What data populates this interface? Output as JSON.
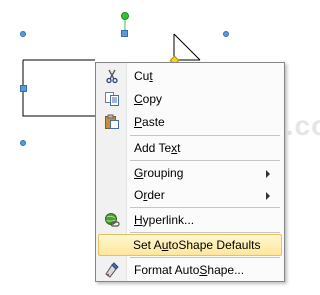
{
  "menu": {
    "items": [
      {
        "label": "Cut",
        "mnemonic_index": 2,
        "icon": "scissors-icon"
      },
      {
        "label": "Copy",
        "mnemonic_index": 0,
        "icon": "copy-icon"
      },
      {
        "label": "Paste",
        "mnemonic_index": 0,
        "icon": "paste-icon"
      },
      {
        "label": "Add Text",
        "mnemonic_index": 6,
        "icon": ""
      },
      {
        "label": "Grouping",
        "mnemonic_index": 0,
        "icon": "",
        "submenu": true
      },
      {
        "label": "Order",
        "mnemonic_index": 1,
        "icon": "",
        "submenu": true
      },
      {
        "label": "Hyperlink...",
        "mnemonic_index": 0,
        "icon": "hyperlink-icon"
      },
      {
        "label": "Set AutoShape Defaults",
        "mnemonic_index": 5,
        "icon": "",
        "highlighted": true
      },
      {
        "label": "Format AutoShape...",
        "mnemonic_index": 12,
        "icon": "format-shape-icon"
      }
    ]
  },
  "watermark": "www.java2s.com"
}
